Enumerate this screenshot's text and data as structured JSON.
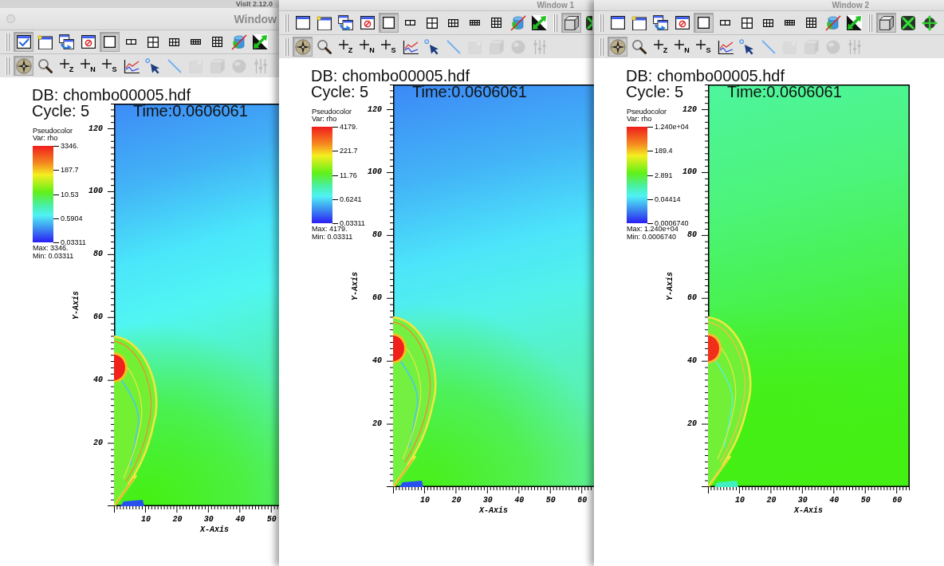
{
  "background_window": {
    "title": "VisIt 2.12.0"
  },
  "windows": [
    {
      "title": "Window",
      "toolbar_rows": [
        {
          "groups": [
            [
              {
                "kind": "window",
                "pressed": true,
                "disabled": false
              },
              {
                "kind": "new-window",
                "pressed": false,
                "disabled": false
              },
              {
                "kind": "clone-window",
                "pressed": false,
                "disabled": false
              },
              {
                "kind": "delete-window",
                "pressed": false,
                "disabled": false
              },
              {
                "kind": "layout-1x1",
                "pressed": true,
                "disabled": false
              },
              {
                "kind": "layout-1x2",
                "pressed": false,
                "disabled": false
              },
              {
                "kind": "layout-2x2",
                "pressed": false,
                "disabled": false
              },
              {
                "kind": "layout-2x3",
                "pressed": false,
                "disabled": false
              },
              {
                "kind": "layout-2x4",
                "pressed": false,
                "disabled": false
              },
              {
                "kind": "layout-3x3",
                "pressed": false,
                "disabled": false
              },
              {
                "kind": "lock",
                "pressed": false,
                "disabled": false
              },
              {
                "kind": "invert",
                "pressed": false,
                "disabled": false
              }
            ]
          ]
        },
        {
          "groups": [
            [
              {
                "kind": "navigate",
                "pressed": true,
                "disabled": false
              },
              {
                "kind": "zoom",
                "pressed": false,
                "disabled": false
              },
              {
                "kind": "pick",
                "subscript": "Z",
                "pressed": false,
                "disabled": false
              },
              {
                "kind": "pick",
                "subscript": "N",
                "pressed": false,
                "disabled": false
              },
              {
                "kind": "pick",
                "subscript": "S",
                "pressed": false,
                "disabled": false
              },
              {
                "kind": "lineout",
                "pressed": false,
                "disabled": false
              },
              {
                "kind": "point-tool",
                "pressed": false,
                "disabled": false
              },
              {
                "kind": "line-tool",
                "pressed": false,
                "disabled": false
              },
              {
                "kind": "plane-tool",
                "pressed": false,
                "disabled": true
              },
              {
                "kind": "box-tool",
                "pressed": false,
                "disabled": true
              },
              {
                "kind": "sphere-tool",
                "pressed": false,
                "disabled": true
              },
              {
                "kind": "axis-tool",
                "pressed": false,
                "disabled": true
              }
            ]
          ]
        }
      ],
      "annotations": {
        "database": "DB: chombo00005.hdf",
        "cycle": "Cycle: 5",
        "time": "Time:0.0606061"
      },
      "legend": {
        "title": "Pseudocolor",
        "variable": "Var: rho",
        "tick_labels": [
          "3346.",
          "187.7",
          "10.53",
          "0.5904",
          "0.03311"
        ],
        "max": "Max: 3346.",
        "min": "Min: 0.03311"
      },
      "y_axis": {
        "title": "Y-Axis",
        "tick_labels": [
          "120",
          "100",
          "80",
          "60",
          "40",
          "20"
        ]
      },
      "x_axis": {
        "title": "X-Axis",
        "tick_labels": [
          "10",
          "20",
          "30",
          "40",
          "50"
        ]
      }
    },
    {
      "title": "Window 1",
      "toolbar_rows": [
        {
          "groups": [
            [
              {
                "kind": "window",
                "pressed": false,
                "disabled": false
              },
              {
                "kind": "new-window",
                "pressed": false,
                "disabled": false
              },
              {
                "kind": "clone-window",
                "pressed": false,
                "disabled": false
              },
              {
                "kind": "delete-window",
                "pressed": false,
                "disabled": false
              },
              {
                "kind": "layout-1x1",
                "pressed": true,
                "disabled": false
              },
              {
                "kind": "layout-1x2",
                "pressed": false,
                "disabled": false
              },
              {
                "kind": "layout-2x2",
                "pressed": false,
                "disabled": false
              },
              {
                "kind": "layout-2x3",
                "pressed": false,
                "disabled": false
              },
              {
                "kind": "layout-2x4",
                "pressed": false,
                "disabled": false
              },
              {
                "kind": "layout-3x3",
                "pressed": false,
                "disabled": false
              },
              {
                "kind": "lock",
                "pressed": false,
                "disabled": false
              },
              {
                "kind": "invert",
                "pressed": false,
                "disabled": false
              }
            ],
            [
              {
                "kind": "perspective",
                "pressed": true,
                "disabled": false
              },
              {
                "kind": "reset-view",
                "pressed": false,
                "disabled": false
              }
            ]
          ]
        },
        {
          "groups": [
            [
              {
                "kind": "navigate",
                "pressed": true,
                "disabled": false
              },
              {
                "kind": "zoom",
                "pressed": false,
                "disabled": false
              },
              {
                "kind": "pick",
                "subscript": "Z",
                "pressed": false,
                "disabled": false
              },
              {
                "kind": "pick",
                "subscript": "N",
                "pressed": false,
                "disabled": false
              },
              {
                "kind": "pick",
                "subscript": "S",
                "pressed": false,
                "disabled": false
              },
              {
                "kind": "lineout",
                "pressed": false,
                "disabled": false
              },
              {
                "kind": "point-tool",
                "pressed": false,
                "disabled": false
              },
              {
                "kind": "line-tool",
                "pressed": false,
                "disabled": false
              },
              {
                "kind": "plane-tool",
                "pressed": false,
                "disabled": true
              },
              {
                "kind": "box-tool",
                "pressed": false,
                "disabled": true
              },
              {
                "kind": "sphere-tool",
                "pressed": false,
                "disabled": true
              },
              {
                "kind": "axis-tool",
                "pressed": false,
                "disabled": true
              }
            ]
          ]
        }
      ],
      "annotations": {
        "database": "DB: chombo00005.hdf",
        "cycle": "Cycle: 5",
        "time": "Time:0.0606061"
      },
      "legend": {
        "title": "Pseudocolor",
        "variable": "Var: rho",
        "tick_labels": [
          "4179.",
          "221.7",
          "11.76",
          "0.6241",
          "0.03311"
        ],
        "max": "Max: 4179.",
        "min": "Min: 0.03311"
      },
      "y_axis": {
        "title": "Y-Axis",
        "tick_labels": [
          "120",
          "100",
          "80",
          "60",
          "40",
          "20"
        ]
      },
      "x_axis": {
        "title": "X-Axis",
        "tick_labels": [
          "10",
          "20",
          "30",
          "40",
          "50",
          "60"
        ]
      }
    },
    {
      "title": "Window 2",
      "toolbar_rows": [
        {
          "groups": [
            [
              {
                "kind": "window",
                "pressed": false,
                "disabled": false
              },
              {
                "kind": "new-window",
                "pressed": false,
                "disabled": false
              },
              {
                "kind": "clone-window",
                "pressed": false,
                "disabled": false
              },
              {
                "kind": "delete-window",
                "pressed": false,
                "disabled": false
              },
              {
                "kind": "layout-1x1",
                "pressed": true,
                "disabled": false
              },
              {
                "kind": "layout-1x2",
                "pressed": false,
                "disabled": false
              },
              {
                "kind": "layout-2x2",
                "pressed": false,
                "disabled": false
              },
              {
                "kind": "layout-2x3",
                "pressed": false,
                "disabled": false
              },
              {
                "kind": "layout-2x4",
                "pressed": false,
                "disabled": false
              },
              {
                "kind": "layout-3x3",
                "pressed": false,
                "disabled": false
              },
              {
                "kind": "lock",
                "pressed": false,
                "disabled": false
              },
              {
                "kind": "invert",
                "pressed": false,
                "disabled": false
              }
            ],
            [
              {
                "kind": "perspective",
                "pressed": true,
                "disabled": false
              },
              {
                "kind": "reset-view",
                "pressed": false,
                "disabled": false
              },
              {
                "kind": "spin",
                "pressed": false,
                "disabled": false
              }
            ]
          ]
        },
        {
          "groups": [
            [
              {
                "kind": "navigate",
                "pressed": true,
                "disabled": false
              },
              {
                "kind": "zoom",
                "pressed": false,
                "disabled": false
              },
              {
                "kind": "pick",
                "subscript": "Z",
                "pressed": false,
                "disabled": false
              },
              {
                "kind": "pick",
                "subscript": "N",
                "pressed": false,
                "disabled": false
              },
              {
                "kind": "pick",
                "subscript": "S",
                "pressed": false,
                "disabled": false
              },
              {
                "kind": "lineout",
                "pressed": false,
                "disabled": false
              },
              {
                "kind": "point-tool",
                "pressed": false,
                "disabled": false
              },
              {
                "kind": "line-tool",
                "pressed": false,
                "disabled": false
              },
              {
                "kind": "plane-tool",
                "pressed": false,
                "disabled": true
              },
              {
                "kind": "box-tool",
                "pressed": false,
                "disabled": true
              },
              {
                "kind": "sphere-tool",
                "pressed": false,
                "disabled": true
              },
              {
                "kind": "axis-tool",
                "pressed": false,
                "disabled": true
              }
            ]
          ]
        }
      ],
      "annotations": {
        "database": "DB: chombo00005.hdf",
        "cycle": "Cycle: 5",
        "time": "Time:0.0606061"
      },
      "legend": {
        "title": "Pseudocolor",
        "variable": "Var: rho",
        "tick_labels": [
          "1.240e+04",
          "189.4",
          "2.891",
          "0.04414",
          "0.0006740"
        ],
        "max": "Max: 1.240e+04",
        "min": "Min: 0.0006740"
      },
      "y_axis": {
        "title": "Y-Axis",
        "tick_labels": [
          "120",
          "100",
          "80",
          "60",
          "40",
          "20"
        ]
      },
      "x_axis": {
        "title": "X-Axis",
        "tick_labels": [
          "10",
          "20",
          "30",
          "40",
          "50",
          "60"
        ]
      }
    }
  ]
}
